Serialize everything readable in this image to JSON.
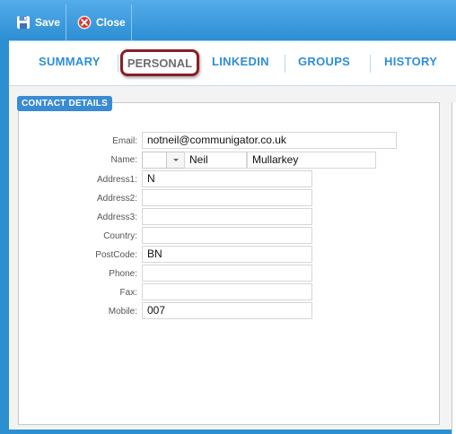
{
  "toolbar": {
    "save_label": "Save",
    "close_label": "Close"
  },
  "tabs": {
    "summary": "SUMMARY",
    "personal": "PERSONAL",
    "linkedin": "LINKEDIN",
    "groups": "GROUPS",
    "history": "HISTORY"
  },
  "section": {
    "title": "CONTACT DETAILS"
  },
  "fields": {
    "email": {
      "label": "Email:",
      "value": "notneil@communigator.co.uk"
    },
    "name": {
      "label": "Name:",
      "title": "",
      "first": "Neil",
      "last": "Mullarkey"
    },
    "address1": {
      "label": "Address1:",
      "value": "N"
    },
    "address2": {
      "label": "Address2:",
      "value": ""
    },
    "address3": {
      "label": "Address3:",
      "value": ""
    },
    "country": {
      "label": "Country:",
      "value": ""
    },
    "postcode": {
      "label": "PostCode:",
      "value": "BN"
    },
    "phone": {
      "label": "Phone:",
      "value": ""
    },
    "fax": {
      "label": "Fax:",
      "value": ""
    },
    "mobile": {
      "label": "Mobile:",
      "value": "007"
    }
  },
  "colors": {
    "toolbar": "#3a9ee3",
    "tab_text": "#2e8ed6",
    "active_tab_highlight": "#8b1e26",
    "legend_bg": "#3a8bd1"
  },
  "icons": {
    "save": "save-icon",
    "close": "close-icon"
  }
}
